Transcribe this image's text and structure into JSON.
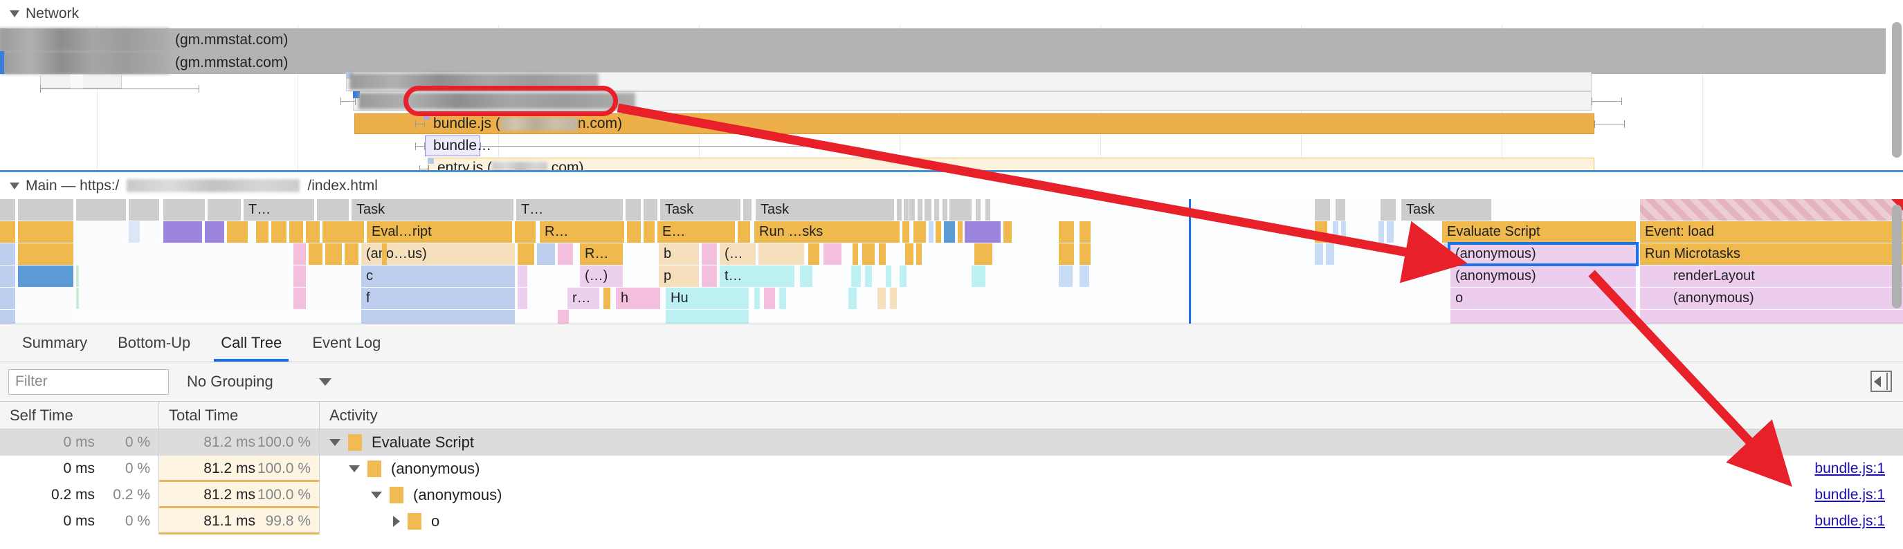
{
  "network": {
    "title": "Network",
    "collapse_icon": "triangle-down-icon",
    "requests": [
      {
        "label": "(gm.mmstat.com)",
        "redacted": true,
        "kind": "gray-bar"
      },
      {
        "label": "(gm.mmstat.com)",
        "redacted": true,
        "kind": "gray-bar"
      },
      {
        "label": "",
        "redacted": true,
        "kind": "gray-box"
      },
      {
        "label": "bundle.js (",
        "label_tail": "n.com)",
        "redacted": true,
        "kind": "script-orange",
        "highlighted": true
      },
      {
        "label": "bundle…",
        "redacted": false,
        "kind": "script-purple"
      },
      {
        "label": "entry.js (",
        "label_tail": ".com)",
        "redacted": true,
        "kind": "script-cream"
      },
      {
        "label": "",
        "redacted": true,
        "kind": "doc-green"
      }
    ]
  },
  "main": {
    "title_prefix": "Main — https:/",
    "title_suffix": "/index.html",
    "collapse_icon": "triangle-down-icon",
    "flame": {
      "row0": [
        {
          "label": "T…",
          "color": "gray"
        },
        {
          "label": "Task",
          "color": "gray"
        },
        {
          "label": "T…",
          "color": "gray"
        },
        {
          "label": "Task",
          "color": "gray"
        },
        {
          "label": "Task",
          "color": "gray"
        },
        {
          "label": "Task",
          "color": "gray"
        }
      ],
      "row1": [
        {
          "label": "Eval…ript",
          "color": "orange"
        },
        {
          "label": "R…",
          "color": "orange"
        },
        {
          "label": "E…",
          "color": "orange"
        },
        {
          "label": "Run …sks",
          "color": "orange"
        },
        {
          "label": "Evaluate Script",
          "color": "orange"
        },
        {
          "label": "Event: load",
          "color": "orange"
        }
      ],
      "row2": [
        {
          "label": "(ano…us)",
          "color": "cream"
        },
        {
          "label": "R…",
          "color": "orange"
        },
        {
          "label": "b",
          "color": "cream"
        },
        {
          "label": "(…",
          "color": "cream"
        },
        {
          "label": "(anonymous)",
          "color": "lpink",
          "selected": true
        },
        {
          "label": "Run Microtasks",
          "color": "orange"
        }
      ],
      "row3": [
        {
          "label": "c",
          "color": "blue"
        },
        {
          "label": "(…)",
          "color": "lpink"
        },
        {
          "label": "p",
          "color": "cream"
        },
        {
          "label": "t…",
          "color": "cyan"
        },
        {
          "label": "(anonymous)",
          "color": "vpink"
        },
        {
          "label": "renderLayout",
          "color": "vpink"
        }
      ],
      "row4": [
        {
          "label": "f",
          "color": "blue"
        },
        {
          "label": "r…",
          "color": "lpink"
        },
        {
          "label": "h",
          "color": "pink"
        },
        {
          "label": "Hu",
          "color": "cyan"
        },
        {
          "label": "o",
          "color": "vpink"
        },
        {
          "label": "(anonymous)",
          "color": "vpink"
        }
      ]
    }
  },
  "tabs": [
    {
      "label": "Summary",
      "active": false
    },
    {
      "label": "Bottom-Up",
      "active": false
    },
    {
      "label": "Call Tree",
      "active": true
    },
    {
      "label": "Event Log",
      "active": false
    }
  ],
  "toolbar": {
    "filter_placeholder": "Filter",
    "filter_value": "",
    "grouping_label": "No Grouping",
    "grouping_caret_icon": "chevron-down-icon",
    "sidebar_toggle_icon": "show-sidebar-icon"
  },
  "tree": {
    "columns": [
      "Self Time",
      "Total Time",
      "Activity"
    ],
    "rows": [
      {
        "self_ms": "0 ms",
        "self_pct": "0 %",
        "total_ms": "81.2 ms",
        "total_pct": "100.0 %",
        "activity": "Evaluate Script",
        "depth": 0,
        "expander": "triangle-down-icon",
        "selected": true,
        "source": "",
        "bar_pct": 100
      },
      {
        "self_ms": "0 ms",
        "self_pct": "0 %",
        "total_ms": "81.2 ms",
        "total_pct": "100.0 %",
        "activity": "(anonymous)",
        "depth": 1,
        "expander": "triangle-down-icon",
        "selected": false,
        "source": "bundle.js:1",
        "bar_pct": 100
      },
      {
        "self_ms": "0.2 ms",
        "self_pct": "0.2 %",
        "total_ms": "81.2 ms",
        "total_pct": "100.0 %",
        "activity": "(anonymous)",
        "depth": 2,
        "expander": "triangle-down-icon",
        "selected": false,
        "source": "bundle.js:1",
        "bar_pct": 100
      },
      {
        "self_ms": "0 ms",
        "self_pct": "0 %",
        "total_ms": "81.1 ms",
        "total_pct": "99.8 %",
        "activity": "o",
        "depth": 3,
        "expander": "triangle-right-icon",
        "selected": false,
        "source": "bundle.js:1",
        "bar_pct": 99.8
      }
    ]
  },
  "annotations": {
    "callout_color": "#e8202a",
    "arrow_color": "#e8202a",
    "selection_color": "#1a73e8",
    "link_color": "#1a0dab"
  }
}
